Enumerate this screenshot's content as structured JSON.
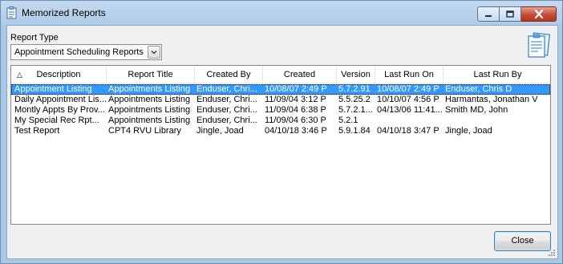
{
  "window": {
    "title": "Memorized Reports",
    "title_icon": "clipboard-icon"
  },
  "report_type": {
    "label": "Report Type",
    "selected": "Appointment Scheduling Reports"
  },
  "list": {
    "sort_indicator": "△",
    "columns": [
      "Description",
      "Report Title",
      "Created By",
      "Created",
      "Version",
      "Last Run On",
      "Last Run By"
    ],
    "rows": [
      {
        "description": "Appointment Listing",
        "report_title": "Appointments Listing",
        "created_by": "Enduser, Chri...",
        "created": "10/08/07 2:49 P",
        "version": "5.7.2.91",
        "last_run_on": "10/08/07 2:49 P",
        "last_run_by": "Enduser, Chris D",
        "selected": true
      },
      {
        "description": "Daily Appointment Lis...",
        "report_title": "Appointments Listing",
        "created_by": "Enduser, Chri...",
        "created": "11/09/04 3:12 P",
        "version": "5.5.25.2",
        "last_run_on": "10/10/07 4:56 P",
        "last_run_by": "Harmantas, Jonathan V",
        "selected": false
      },
      {
        "description": "Montly Appts By Prov...",
        "report_title": "Appointments Listing",
        "created_by": "Enduser, Chri...",
        "created": "11/09/04 6:38 P",
        "version": "5.7.2.1...",
        "last_run_on": "04/13/06 11:41...",
        "last_run_by": "Smith MD, John",
        "selected": false
      },
      {
        "description": "My Special Rec Rpt...",
        "report_title": "Appointments Listing",
        "created_by": "Enduser, Chri...",
        "created": "11/09/04 6:30 P",
        "version": "5.2.1",
        "last_run_on": "",
        "last_run_by": "",
        "selected": false
      },
      {
        "description": "Test Report",
        "report_title": "CPT4 RVU Library",
        "created_by": "Jingle, Joad",
        "created": "04/10/18 3:46 P",
        "version": "5.9.1.84",
        "last_run_on": "04/10/18 3:47 P",
        "last_run_by": "Jingle, Joad",
        "selected": false
      }
    ]
  },
  "buttons": {
    "close": "Close"
  },
  "colors": {
    "selection": "#3399ff",
    "close_button": "#c44b34",
    "frame": "#a9c8e6"
  }
}
